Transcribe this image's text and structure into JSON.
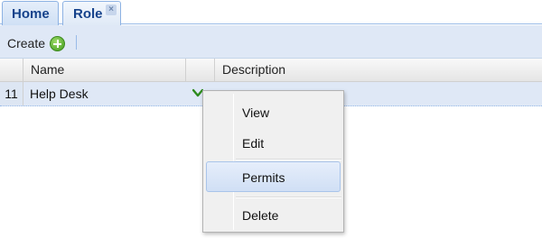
{
  "tabs": [
    {
      "label": "Home"
    },
    {
      "label": "Role",
      "close": "×"
    }
  ],
  "toolbar": {
    "create_label": "Create",
    "create_icon": "plus-circle-icon"
  },
  "grid": {
    "columns": [
      "",
      "Name",
      "",
      "Description"
    ],
    "rows": [
      {
        "num": "11",
        "name": "Help Desk",
        "description": ""
      }
    ],
    "row_trigger_icon": "chevron-down-icon"
  },
  "context_menu": {
    "items": [
      {
        "label": "View"
      },
      {
        "label": "Edit"
      },
      {
        "label": "Permits"
      },
      {
        "label": "Delete"
      }
    ]
  },
  "colors": {
    "accent": "#15428b",
    "toolbar_bg": "#dfe8f6",
    "trigger_green": "#2e8b1e"
  }
}
